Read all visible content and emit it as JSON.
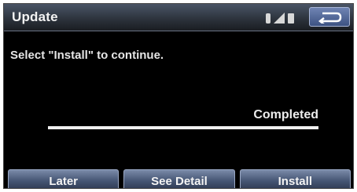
{
  "screen": {
    "title": "Update",
    "instruction": "Select \"Install\" to continue.",
    "status_label": "Completed",
    "progress": 1.0
  },
  "status_icons": [
    "bluetooth-icon",
    "signal-strength-icon",
    "battery-icon"
  ],
  "back_button_icon": "back-arrow-icon",
  "buttons": {
    "later": "Later",
    "see_detail": "See Detail",
    "install": "Install"
  },
  "colors": {
    "background": "#000000",
    "title_bar": "#2b313a",
    "button": "#465674",
    "text": "#eaeaea"
  }
}
